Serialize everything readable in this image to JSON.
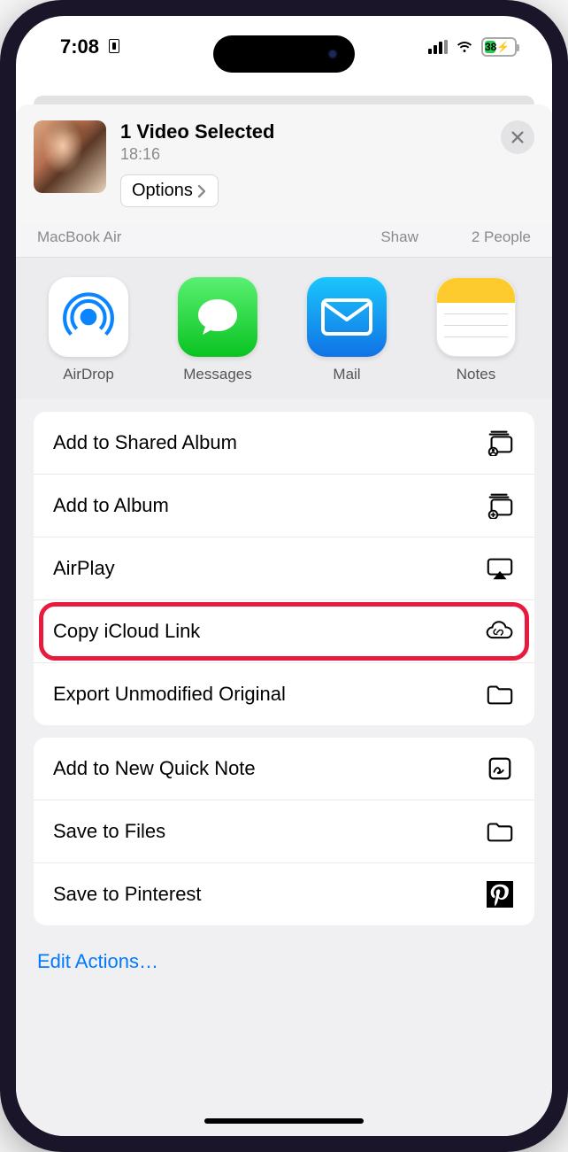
{
  "status": {
    "time": "7:08",
    "battery_pct": "38"
  },
  "header": {
    "title": "1 Video Selected",
    "time": "18:16",
    "options_label": "Options"
  },
  "airdrop_targets": [
    {
      "label": "MacBook Air"
    },
    {
      "label": "Shaw"
    },
    {
      "label": "2 People"
    }
  ],
  "apps": [
    {
      "label": "AirDrop",
      "icon": "airdrop"
    },
    {
      "label": "Messages",
      "icon": "messages"
    },
    {
      "label": "Mail",
      "icon": "mail"
    },
    {
      "label": "Notes",
      "icon": "notes"
    }
  ],
  "action_groups": [
    [
      {
        "label": "Add to Shared Album",
        "icon": "shared-album",
        "highlight": false
      },
      {
        "label": "Add to Album",
        "icon": "add-album",
        "highlight": false
      },
      {
        "label": "AirPlay",
        "icon": "airplay",
        "highlight": false
      },
      {
        "label": "Copy iCloud Link",
        "icon": "icloud-link",
        "highlight": true
      },
      {
        "label": "Export Unmodified Original",
        "icon": "folder",
        "highlight": false
      }
    ],
    [
      {
        "label": "Add to New Quick Note",
        "icon": "quick-note",
        "highlight": false
      },
      {
        "label": "Save to Files",
        "icon": "folder",
        "highlight": false
      },
      {
        "label": "Save to Pinterest",
        "icon": "pinterest",
        "highlight": false
      }
    ]
  ],
  "edit_actions_label": "Edit Actions…"
}
